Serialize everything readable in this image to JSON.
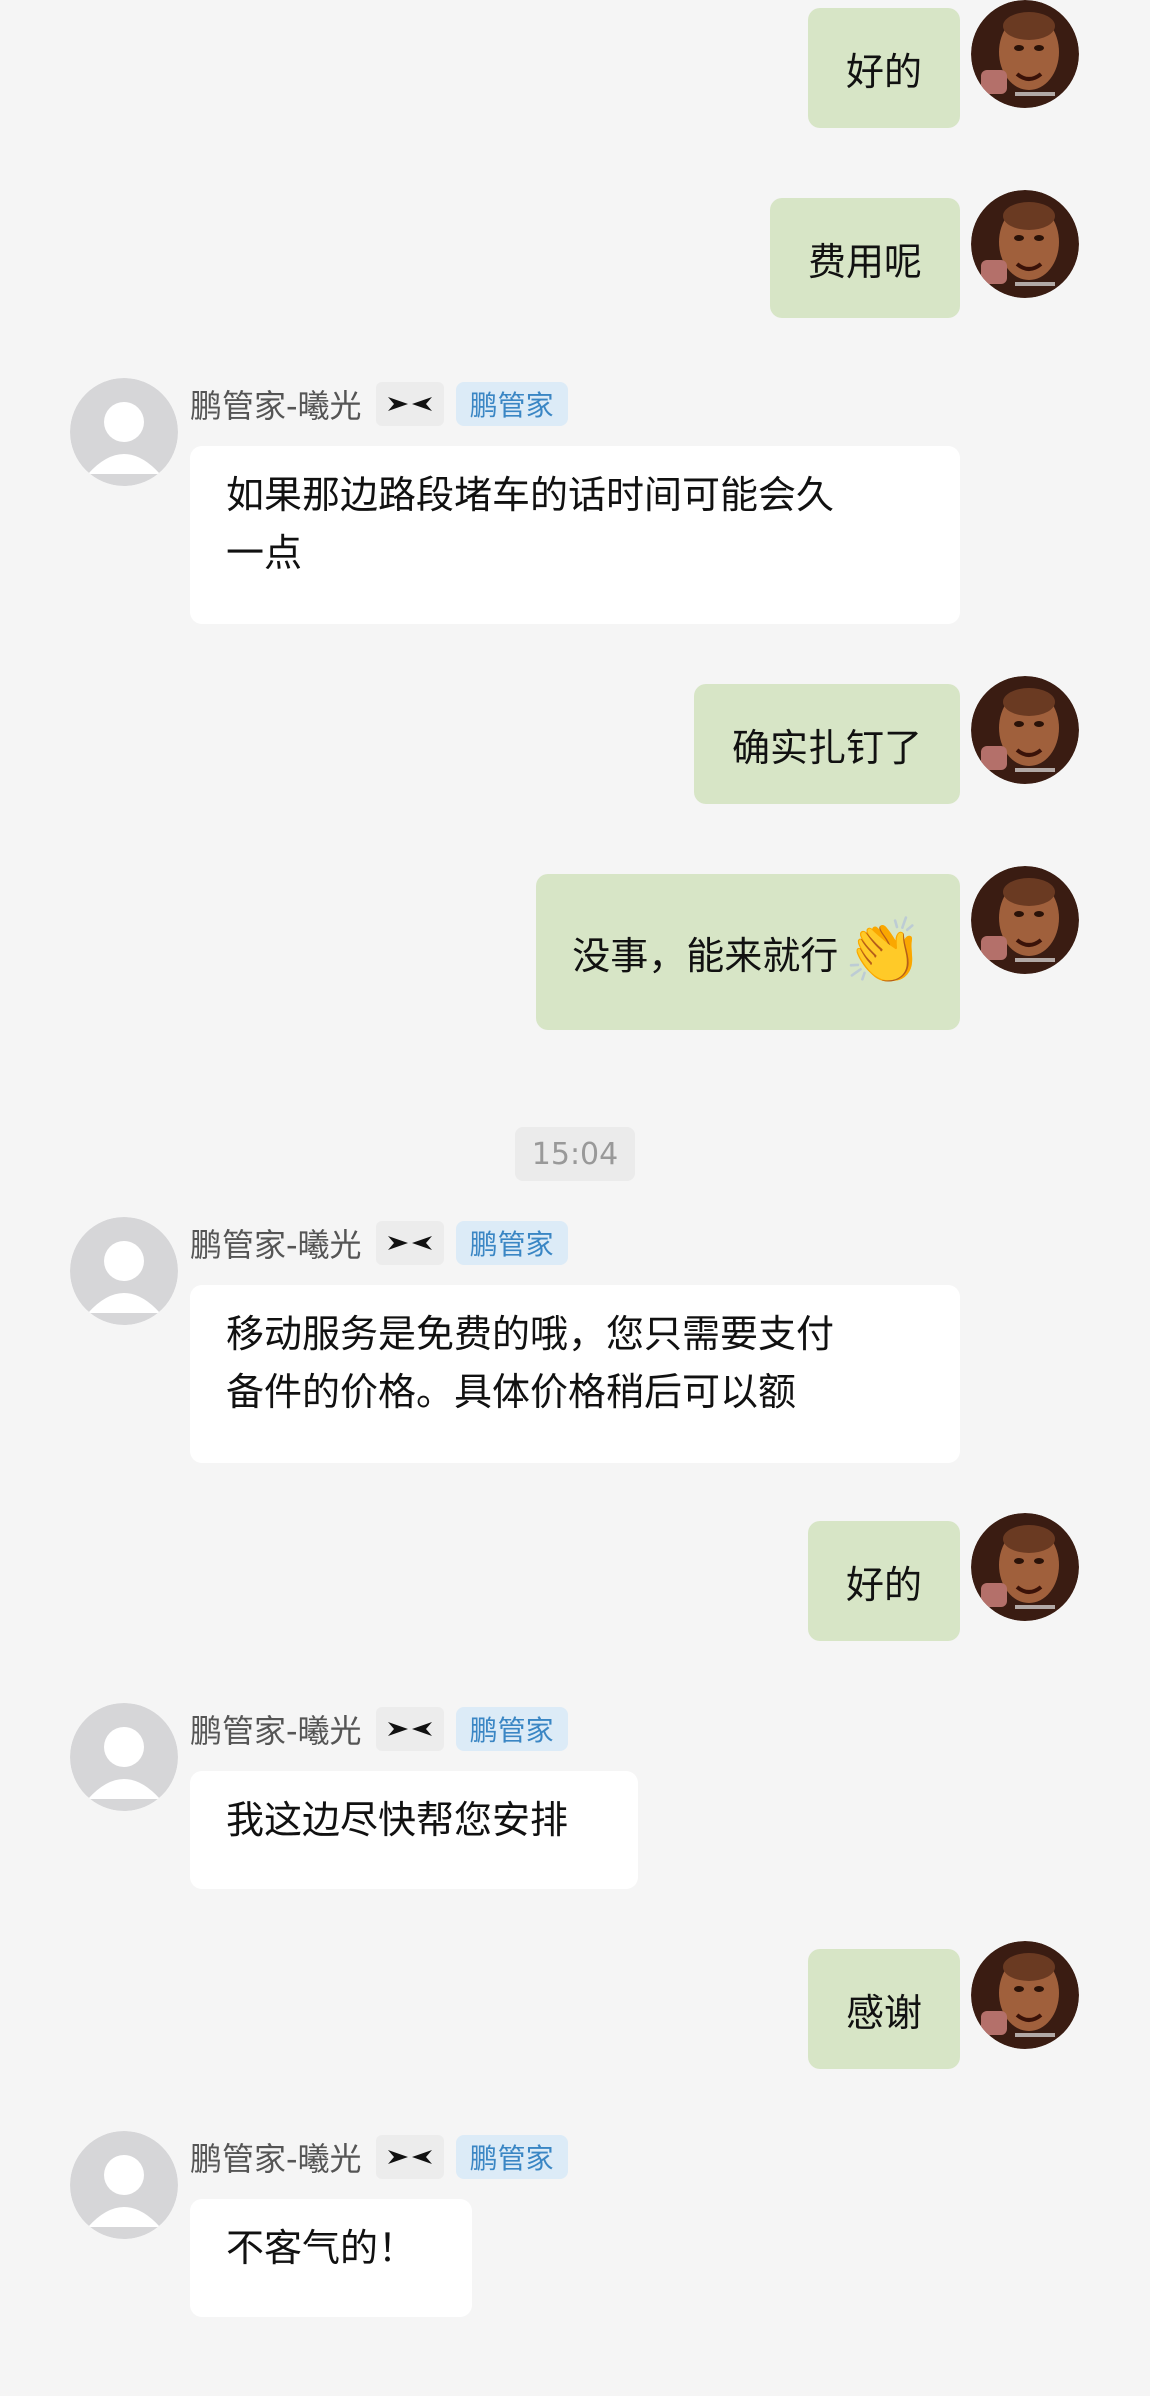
{
  "colors": {
    "background": "#f5f5f5",
    "outgoing_bubble": "#d7e5c6",
    "incoming_bubble": "#ffffff",
    "tag_background": "#dcebf7",
    "tag_text": "#3a86c4",
    "timestamp_background": "#ebebeb"
  },
  "agent": {
    "name": "鹏管家-曦光",
    "tag": "鹏管家",
    "logo_icon": "xpeng-logo-icon"
  },
  "user": {
    "avatar_icon": "user-avatar-photo-icon"
  },
  "timestamp": "15:04",
  "messages": [
    {
      "from": "user",
      "text": "好的"
    },
    {
      "from": "user",
      "text": "费用呢"
    },
    {
      "from": "agent",
      "lines": [
        "如果那边路段堵车的话时间可能会久",
        "一点"
      ]
    },
    {
      "from": "user",
      "text": "确实扎钉了"
    },
    {
      "from": "user",
      "text": "没事，能来就行",
      "emoji": "👏"
    },
    {
      "from": "agent",
      "lines": [
        "移动服务是免费的哦，您只需要支付",
        "备件的价格。具体价格稍后可以额"
      ]
    },
    {
      "from": "user",
      "text": "好的"
    },
    {
      "from": "agent",
      "lines": [
        "我这边尽快帮您安排"
      ]
    },
    {
      "from": "user",
      "text": "感谢"
    },
    {
      "from": "agent",
      "lines": [
        "不客气的！"
      ]
    }
  ]
}
